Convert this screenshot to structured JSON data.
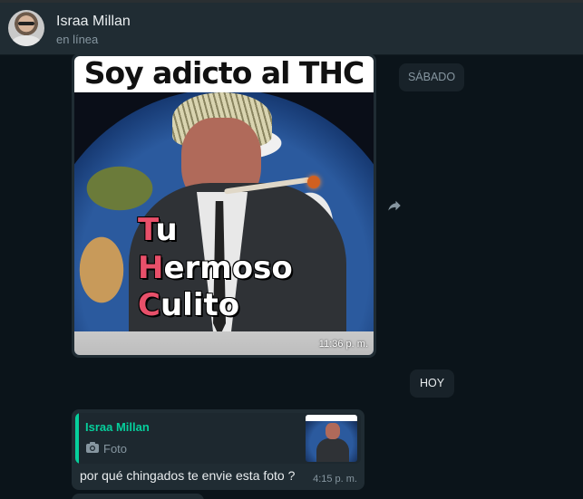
{
  "header": {
    "contact_name": "Israa Millan",
    "status": "en línea"
  },
  "messages": {
    "image_message": {
      "meme_top_text": "Soy adicto al THC",
      "meme_lines": [
        {
          "cap": "T",
          "rest": "u"
        },
        {
          "cap": "H",
          "rest": "ermoso"
        },
        {
          "cap": "C",
          "rest": "ulito"
        }
      ],
      "time": "11:36 p. m.",
      "forward_icon": "forward-arrow-icon"
    },
    "date_separators": {
      "saturday": "SÁBADO",
      "today": "HOY"
    },
    "reply_message": {
      "quoted_author": "Israa Millan",
      "quoted_type": "Foto",
      "quoted_icon": "camera-icon",
      "text": "por qué chingados te envie esta foto ?",
      "time": "4:15 p. m."
    }
  },
  "colors": {
    "background": "#0b141a",
    "header": "#202c33",
    "bubble": "#202c33",
    "accent": "#06cf9c",
    "meme_capital": "#e8506a"
  }
}
